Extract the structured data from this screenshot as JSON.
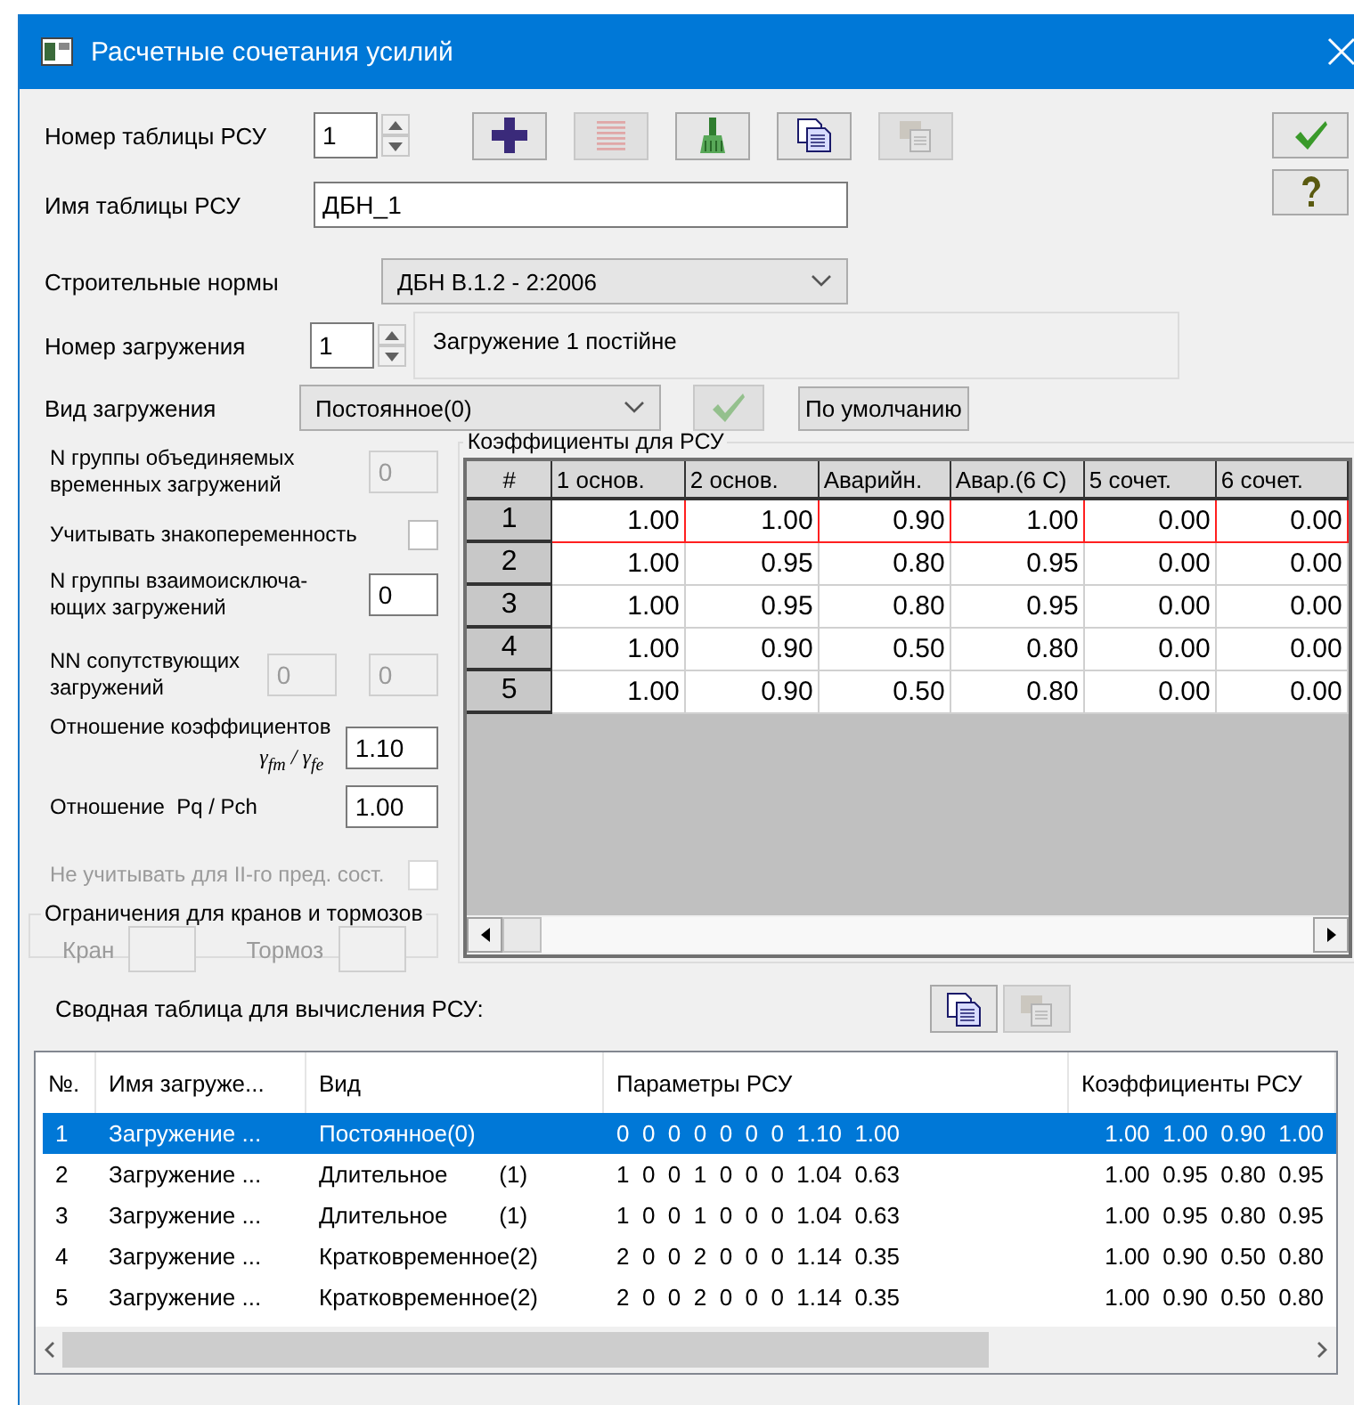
{
  "window": {
    "title": "Расчетные сочетания усилий"
  },
  "table_number": {
    "label": "Номер таблицы РСУ",
    "value": "1"
  },
  "toolbar": [
    {
      "kind": "add",
      "disabled": false
    },
    {
      "kind": "delete",
      "disabled": true
    },
    {
      "kind": "brush",
      "disabled": false
    },
    {
      "kind": "copy",
      "disabled": false
    },
    {
      "kind": "paste",
      "disabled": true
    }
  ],
  "side_buttons": [
    {
      "kind": "ok"
    },
    {
      "kind": "help"
    }
  ],
  "table_name": {
    "label": "Имя таблицы РСУ",
    "value": "ДБН_1"
  },
  "norms": {
    "label": "Строительные нормы",
    "value": "ДБН В.1.2 - 2:2006"
  },
  "load_number": {
    "label": "Номер загружения",
    "value": "1",
    "description": "Загружение 1 постійне"
  },
  "load_type": {
    "label": "Вид загружения",
    "value": "Постоянное(0)",
    "apply_disabled": true,
    "default_button": "По умолчанию"
  },
  "params": [
    {
      "kind": "input",
      "label": "N группы объединяемых\nвременных загружений",
      "fields": [
        {
          "value": "0",
          "disabled": true
        }
      ]
    },
    {
      "kind": "checkbox",
      "label": "Учитывать знакопеременность",
      "disabled": false,
      "checked": false
    },
    {
      "kind": "input",
      "label": "N группы взаимоисключа-\nющих загружений",
      "fields": [
        {
          "value": "0",
          "disabled": false
        }
      ]
    },
    {
      "kind": "input",
      "label": "NN сопутствующих\nзагружений",
      "fields": [
        {
          "value": "0",
          "disabled": true
        },
        {
          "value": "0",
          "disabled": true
        }
      ]
    },
    {
      "kind": "ratio",
      "label": "Отношение коэффициентов",
      "sublabel": "γ$_{fm}$ / γ$_{fe}$",
      "fields": [
        {
          "value": "1.10",
          "disabled": false
        }
      ]
    },
    {
      "kind": "input",
      "label": "Отношение  Pq / Pch",
      "fields": [
        {
          "value": "1.00",
          "disabled": false
        }
      ]
    },
    {
      "kind": "checkbox",
      "label": "Не учитывать для II-го пред. сост.",
      "disabled": true,
      "checked": false
    }
  ],
  "crane_limits": {
    "title": "Ограничения для кранов и тормозов",
    "fields": [
      {
        "label": "Кран",
        "disabled": true
      },
      {
        "label": "Тормоз",
        "disabled": true
      }
    ]
  },
  "coefficients": {
    "title": "Коэффициенты для РСУ",
    "columns": [
      "#",
      "1 основ.",
      "2 основ.",
      "Аварийн.",
      "Авар.(6 С)",
      "5 сочет.",
      "6 сочет."
    ],
    "rows": [
      {
        "label": "1",
        "values": [
          "1.00",
          "1.00",
          "0.90",
          "1.00",
          "0.00",
          "0.00"
        ],
        "selected": true
      },
      {
        "label": "2",
        "values": [
          "1.00",
          "0.95",
          "0.80",
          "0.95",
          "0.00",
          "0.00"
        ],
        "selected": false
      },
      {
        "label": "3",
        "values": [
          "1.00",
          "0.95",
          "0.80",
          "0.95",
          "0.00",
          "0.00"
        ],
        "selected": false
      },
      {
        "label": "4",
        "values": [
          "1.00",
          "0.90",
          "0.50",
          "0.80",
          "0.00",
          "0.00"
        ],
        "selected": false
      },
      {
        "label": "5",
        "values": [
          "1.00",
          "0.90",
          "0.50",
          "0.80",
          "0.00",
          "0.00"
        ],
        "selected": false
      }
    ]
  },
  "summary": {
    "label": "Сводная таблица для вычисления РСУ:",
    "buttons": [
      {
        "kind": "copy",
        "disabled": false
      },
      {
        "kind": "paste",
        "disabled": true
      }
    ],
    "columns": [
      "№.",
      "Имя загруже...",
      "Вид",
      "Параметры РСУ",
      "Коэффициенты РСУ"
    ],
    "rows": [
      {
        "cells": [
          "1",
          "Загружение ...",
          "Постоянное(0)",
          "0  0  0  0  0  0  0  1.10  1.00",
          "1.00  1.00  0.90  1.00"
        ],
        "selected": true
      },
      {
        "cells": [
          "2",
          "Загружение ...",
          "Длительное        (1)",
          "1  0  0  1  0  0  0  1.04  0.63",
          "1.00  0.95  0.80  0.95"
        ],
        "selected": false
      },
      {
        "cells": [
          "3",
          "Загружение ...",
          "Длительное        (1)",
          "1  0  0  1  0  0  0  1.04  0.63",
          "1.00  0.95  0.80  0.95"
        ],
        "selected": false
      },
      {
        "cells": [
          "4",
          "Загружение ...",
          "Кратковременное(2)",
          "2  0  0  2  0  0  0  1.14  0.35",
          "1.00  0.90  0.50  0.80"
        ],
        "selected": false
      },
      {
        "cells": [
          "5",
          "Загружение ...",
          "Кратковременное(2)",
          "2  0  0  2  0  0  0  1.14  0.35",
          "1.00  0.90  0.50  0.80"
        ],
        "selected": false
      }
    ]
  }
}
